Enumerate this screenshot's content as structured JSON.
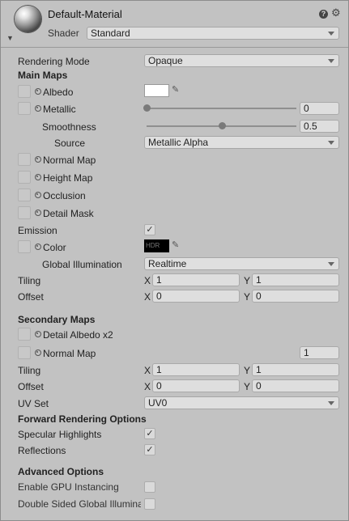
{
  "header": {
    "material_name": "Default-Material",
    "shader_label": "Shader",
    "shader_value": "Standard"
  },
  "rendering_mode": {
    "label": "Rendering Mode",
    "value": "Opaque"
  },
  "main_maps": {
    "title": "Main Maps",
    "albedo": "Albedo",
    "metallic": "Metallic",
    "metallic_value": "0",
    "metallic_level": 0,
    "smoothness": "Smoothness",
    "smoothness_value": "0.5",
    "smoothness_level": 0.5,
    "source": "Source",
    "source_value": "Metallic Alpha",
    "normal_map": "Normal Map",
    "height_map": "Height Map",
    "occlusion": "Occlusion",
    "detail_mask": "Detail Mask",
    "emission": "Emission",
    "color": "Color",
    "hdr_text": "HDR",
    "global_illumination": "Global Illumination",
    "gi_value": "Realtime",
    "tiling": "Tiling",
    "tiling_x": "1",
    "tiling_y": "1",
    "offset": "Offset",
    "offset_x": "0",
    "offset_y": "0",
    "albedo_color": "#ffffff"
  },
  "secondary_maps": {
    "title": "Secondary Maps",
    "detail_albedo": "Detail Albedo x2",
    "normal_map": "Normal Map",
    "normal_scale": "1",
    "tiling": "Tiling",
    "tiling_x": "1",
    "tiling_y": "1",
    "offset": "Offset",
    "offset_x": "0",
    "offset_y": "0",
    "uv_set": "UV Set",
    "uv_value": "UV0"
  },
  "forward_rendering": {
    "title": "Forward Rendering Options",
    "specular": "Specular Highlights",
    "reflections": "Reflections"
  },
  "advanced": {
    "title": "Advanced Options",
    "gpu_instancing": "Enable GPU Instancing",
    "double_sided_gi": "Double Sided Global Illumina"
  },
  "axis_labels": {
    "x": "X",
    "y": "Y"
  }
}
